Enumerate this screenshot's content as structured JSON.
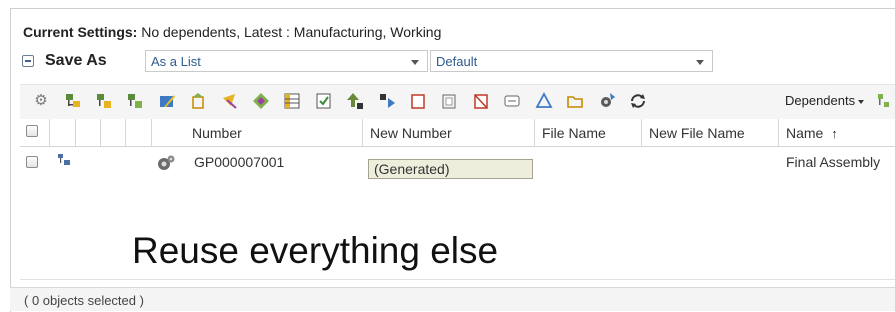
{
  "settings": {
    "label": "Current Settings:",
    "value": " No dependents, Latest : Manufacturing, Working"
  },
  "saveas": {
    "label": "Save As",
    "view_select": "As a List",
    "view_select_options": [
      "As a List"
    ],
    "filter_select": "Default",
    "filter_select_options": [
      "Default"
    ]
  },
  "toolbar": {
    "icons": [
      "settings-gear-icon",
      "structure-tree-icon",
      "add-parts-icon",
      "insert-part-icon",
      "edit-attributes-icon",
      "new-part-icon",
      "wand-icon",
      "replace-icon",
      "table-grid-icon",
      "checklist-icon",
      "move-up-icon",
      "move-down-icon",
      "clear-icon",
      "select-all-icon",
      "remove-icon",
      "rename-icon",
      "recycle-icon",
      "folder-icon",
      "revise-icon",
      "refresh-icon"
    ],
    "dependents_label": "Dependents"
  },
  "table": {
    "columns": [
      "",
      "",
      "",
      "",
      "",
      "Number",
      "New Number",
      "File Name",
      "New File Name",
      "Name"
    ],
    "sort_indicator": "↑",
    "rows": [
      {
        "number": "GP000007001",
        "new_number": "(Generated)",
        "file_name": "",
        "new_file_name": "",
        "name": "Final Assembly"
      }
    ]
  },
  "overlay_text": "Reuse everything else",
  "status": "( 0 objects selected )",
  "colors": {
    "select_text": "#2f5b8e",
    "generated_field_bg": "#eeeedc",
    "toolbar_bg": "#f5f5f5"
  }
}
